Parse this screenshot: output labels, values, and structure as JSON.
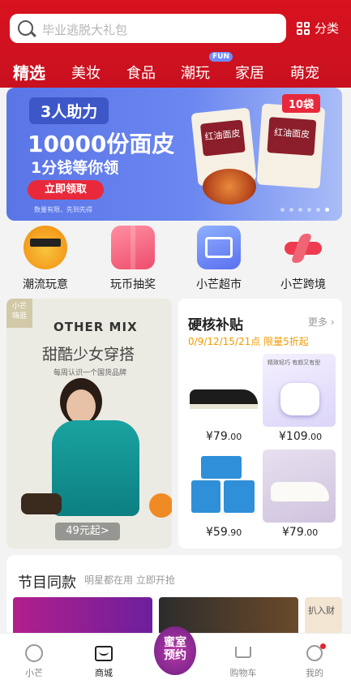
{
  "search": {
    "placeholder": "毕业逃脱大礼包",
    "category_label": "分类"
  },
  "tabs": [
    {
      "label": "精选",
      "active": true
    },
    {
      "label": "美妆"
    },
    {
      "label": "食品"
    },
    {
      "label": "潮玩",
      "badge": "FUN"
    },
    {
      "label": "家居"
    },
    {
      "label": "萌宠"
    }
  ],
  "banner": {
    "tag": "3人助力",
    "title": "10000份面皮",
    "subtitle": "1分钱等你领",
    "button": "立即领取",
    "fine_print": "数量有限，先到先得",
    "pack_badge": "10袋",
    "pack_label": "红油面皮"
  },
  "quick": [
    {
      "label": "潮流玩意",
      "icon": "sunglasses-emoji-icon"
    },
    {
      "label": "玩币抽奖",
      "icon": "gift-box-icon"
    },
    {
      "label": "小芒超市",
      "icon": "shopping-basket-icon"
    },
    {
      "label": "小芒跨境",
      "icon": "airplane-icon"
    }
  ],
  "left_card": {
    "tag": "小芒\n嗨逛",
    "brand": "OTHER MIX",
    "title": "甜酷少女穿搭",
    "subtitle": "每周认识一个国货品牌",
    "price": "49元起>"
  },
  "right_card": {
    "title": "硬核补贴",
    "more": "更多",
    "subtitle": "0/9/12/15/21点 限量5折起",
    "products": [
      {
        "price": "¥79",
        "decimal": ".00",
        "kind": "canvas-shoe"
      },
      {
        "price": "¥109",
        "decimal": ".00",
        "kind": "earbuds",
        "caption": "精致轻巧 有颜又有型"
      },
      {
        "price": "¥59",
        "decimal": ".90",
        "kind": "pads"
      },
      {
        "price": "¥79",
        "decimal": ".00",
        "kind": "sneakers"
      }
    ]
  },
  "section2": {
    "title": "节目同款",
    "subtitle": "明星都在用 立即开抢",
    "img3_text": "扒入财"
  },
  "bottom_nav": [
    {
      "label": "小芒",
      "icon": "home-loop-icon"
    },
    {
      "label": "商城",
      "icon": "mall-bag-icon",
      "active": true
    },
    {
      "label": "",
      "icon": "center-promo"
    },
    {
      "label": "购物车",
      "icon": "cart-icon"
    },
    {
      "label": "我的",
      "icon": "profile-icon"
    }
  ],
  "center_button": {
    "line1": "蜜室",
    "line2": "预约"
  },
  "colors": {
    "brand_red": "#d8121e",
    "accent_orange": "#f39a00",
    "banner_blue": "#5a75e6"
  }
}
